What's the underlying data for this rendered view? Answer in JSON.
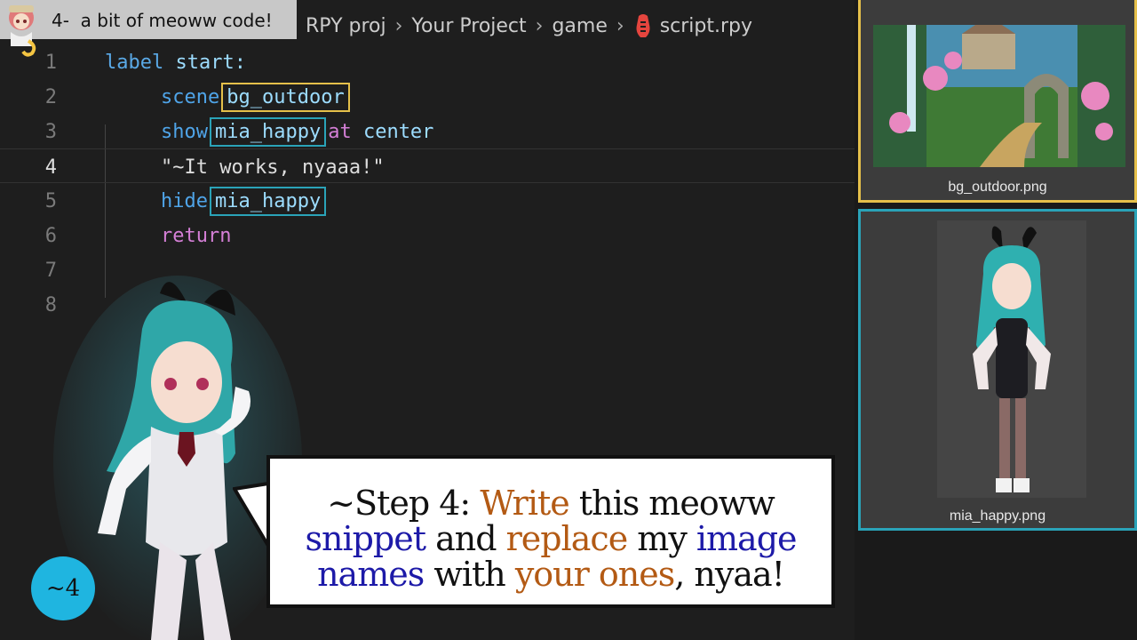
{
  "title_chip": {
    "label": "4-  a bit of meoww code!"
  },
  "breadcrumb": {
    "items": [
      "RPY proj",
      "Your Project",
      "game",
      "script.rpy"
    ]
  },
  "editor": {
    "line_numbers": [
      "1",
      "2",
      "3",
      "4",
      "5",
      "6",
      "7",
      "8"
    ],
    "active_line": "4",
    "lines": [
      {
        "kw": "label",
        "rest": "start:"
      },
      {
        "kw": "scene",
        "target": "bg_outdoor"
      },
      {
        "kw": "show",
        "target": "mia_happy",
        "kw2": "at",
        "rest": "center"
      },
      {
        "str": "\"~It works, nyaaa!\""
      },
      {
        "kw": "hide",
        "target": "mia_happy"
      },
      {
        "kw": "return"
      }
    ]
  },
  "assets": {
    "outdoor_caption": "bg_outdoor.png",
    "mia_caption": "mia_happy.png"
  },
  "bubble": {
    "p1": "~Step 4: ",
    "write": "Write",
    "p2": " this meoww ",
    "snippet": "snippet",
    "p3": " and ",
    "replace": "replace",
    "p4": " my ",
    "image": "image",
    "names": "names",
    "p5": " with ",
    "your_ones": "your ones",
    "p6": ", nyaa!"
  },
  "step_badge": {
    "label": "~4"
  },
  "colors": {
    "editor_bg": "#1e1e1e",
    "keyword": "#4fa4e8",
    "purple_keyword": "#d47fd6",
    "highlight_yellow": "#e5c04a",
    "highlight_teal": "#2aa3b8",
    "badge": "#1fb5e0",
    "text_orange": "#b35a14",
    "text_blue": "#1d1aa8"
  }
}
